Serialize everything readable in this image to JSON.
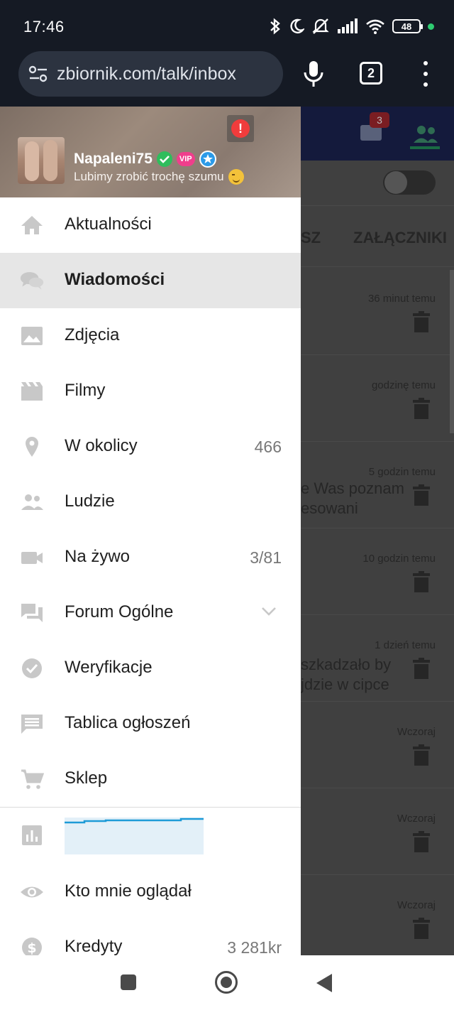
{
  "status_bar": {
    "time": "17:46",
    "battery": "48",
    "icons": [
      "bluetooth-icon",
      "moon-icon",
      "mute-icon",
      "signal-icon",
      "wifi-icon",
      "battery-icon",
      "privacy-dot"
    ]
  },
  "browser": {
    "url": "zbiornik.com/talk/inbox",
    "tab_count": "2"
  },
  "background_page": {
    "camera_badge": "3",
    "tabs": [
      "SZ",
      "ZAŁĄCZNIKI"
    ],
    "rows": [
      {
        "time": "36 minut temu",
        "snippet": ""
      },
      {
        "time": "godzinę temu",
        "snippet": ""
      },
      {
        "time": "5 godzin temu",
        "snippet": "e Was poznam\nesowani"
      },
      {
        "time": "10 godzin temu",
        "snippet": ""
      },
      {
        "time": "1 dzień temu",
        "snippet": "szkadzało by\njdzie w cipce"
      },
      {
        "time": "Wczoraj",
        "snippet": ""
      },
      {
        "time": "Wczoraj",
        "snippet": ""
      },
      {
        "time": "Wczoraj",
        "snippet": ""
      }
    ]
  },
  "drawer": {
    "user": {
      "name": "Napaleni75",
      "vip_label": "VIP",
      "status": "Lubimy zrobić trochę szumu"
    },
    "alert": "!",
    "items": [
      {
        "label": "Aktualności",
        "icon": "home-icon",
        "count": ""
      },
      {
        "label": "Wiadomości",
        "icon": "chat-icon",
        "count": "",
        "active": true
      },
      {
        "label": "Zdjęcia",
        "icon": "image-icon",
        "count": ""
      },
      {
        "label": "Filmy",
        "icon": "movie-icon",
        "count": ""
      },
      {
        "label": "W okolicy",
        "icon": "location-icon",
        "count": "466"
      },
      {
        "label": "Ludzie",
        "icon": "people-icon",
        "count": ""
      },
      {
        "label": "Na żywo",
        "icon": "video-camera-icon",
        "count": "3/81"
      },
      {
        "label": "Forum Ogólne",
        "icon": "forum-icon",
        "count": ""
      },
      {
        "label": "Weryfikacje",
        "icon": "check-circle-icon",
        "count": ""
      },
      {
        "label": "Tablica ogłoszeń",
        "icon": "message-board-icon",
        "count": ""
      },
      {
        "label": "Sklep",
        "icon": "cart-icon",
        "count": ""
      }
    ],
    "stats_icon": "bar-chart-icon",
    "bottom_items": [
      {
        "label": "Kto mnie oglądał",
        "icon": "eye-icon",
        "count": ""
      },
      {
        "label": "Kredyty",
        "icon": "dollar-icon",
        "count": "3 281kr"
      }
    ]
  },
  "colors": {
    "status_bg": "#151a24",
    "drawer_bg": "#ffffff",
    "active_item_bg": "#e6e6e6",
    "chart_line": "#1e9bd7",
    "chart_fill": "#e3f0f8"
  }
}
